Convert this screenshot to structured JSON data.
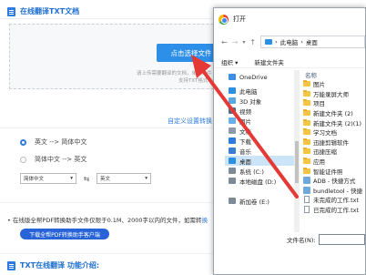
{
  "page": {
    "header_title": "在线翻译TXT文档",
    "upload_button": "点击选择文件",
    "upload_hint": "请上传需要翻译的文档，单个文件",
    "upload_hint2": "支持TXT格式",
    "custom_link": "自定义设置转换",
    "options": [
      "英文 --> 简体中文",
      "简体中文 --> 英文"
    ],
    "source_lang": "简体中文",
    "target_lang": "英文",
    "swap_icon": "swap-arrows-icon",
    "notice": "在线版全帮PDF转换助手文件仅限于0.1M、2000字以内的文件，如需转",
    "notice_highlight": "换",
    "download_button": "下载全帮PDF转换助手客户端",
    "footer_title": "TXT在线翻译 功能介绍:"
  },
  "dialog": {
    "title": "打开",
    "nav": {
      "back": "←",
      "forward": "→",
      "up": "↑"
    },
    "address": [
      "›",
      "此电脑",
      "›",
      "桌面"
    ],
    "toolbar": {
      "organize": "组织 ▾",
      "new_folder": "新建文件夹"
    },
    "tree": [
      {
        "label": "OneDrive",
        "icon": "cloud-icon",
        "color": "#3c8fe6",
        "selected": false,
        "top": true
      },
      {
        "label": "此电脑",
        "icon": "computer-icon",
        "color": "#2b8fe6",
        "selected": false
      },
      {
        "label": "3D 对象",
        "icon": "3d-objects-icon",
        "color": "#5aa7e6",
        "selected": false
      },
      {
        "label": "视频",
        "icon": "video-icon",
        "color": "#4d6c8a",
        "selected": false
      },
      {
        "label": "图片",
        "icon": "pictures-icon",
        "color": "#6ab0e8",
        "selected": false
      },
      {
        "label": "文档",
        "icon": "documents-icon",
        "color": "#8e9bab",
        "selected": false
      },
      {
        "label": "下载",
        "icon": "download-icon",
        "color": "#2d7be0",
        "selected": false
      },
      {
        "label": "音乐",
        "icon": "music-icon",
        "color": "#3a7fd5",
        "selected": false
      },
      {
        "label": "桌面",
        "icon": "desktop-icon",
        "color": "#2b8fe6",
        "selected": true
      },
      {
        "label": "系统 (C:)",
        "icon": "drive-icon",
        "color": "#7d8b99",
        "selected": false
      },
      {
        "label": "本地磁盘 (D:)",
        "icon": "drive-icon",
        "color": "#7d8b99",
        "selected": false
      },
      {
        "label": "",
        "icon": "",
        "color": "#ffffff",
        "selected": false
      },
      {
        "label": "新加卷 (E:)",
        "icon": "drive-icon",
        "color": "#7d8b99",
        "selected": false
      },
      {
        "label": "",
        "icon": "",
        "color": "#ffffff",
        "selected": false
      },
      {
        "label": "",
        "icon": "",
        "color": "#ffffff",
        "selected": false
      },
      {
        "label": "",
        "icon": "",
        "color": "#ffffff",
        "selected": false
      }
    ],
    "column_header": "名称",
    "files": [
      {
        "name": "图片",
        "type": "folder"
      },
      {
        "name": "万能录屏大师",
        "type": "folder"
      },
      {
        "name": "项目",
        "type": "folder"
      },
      {
        "name": "新建文件夹 (2)",
        "type": "folder"
      },
      {
        "name": "新建文件夹 (2)(1)",
        "type": "folder"
      },
      {
        "name": "学习文档",
        "type": "folder"
      },
      {
        "name": "迅捷剪辑软件",
        "type": "folder"
      },
      {
        "name": "迅捷压缩",
        "type": "folder"
      },
      {
        "name": "应用",
        "type": "folder"
      },
      {
        "name": "智能证件照",
        "type": "folder"
      },
      {
        "name": "ADB - 快捷方式",
        "type": "exe"
      },
      {
        "name": "bundletool - 快捷",
        "type": "exe"
      },
      {
        "name": "未完成的工作.txt",
        "type": "file"
      },
      {
        "name": "已完成的工作.txt",
        "type": "file"
      }
    ],
    "filename_label": "文件名(N):"
  },
  "colors": {
    "accent": "#2e8fe8",
    "arrow": "#e53935"
  }
}
